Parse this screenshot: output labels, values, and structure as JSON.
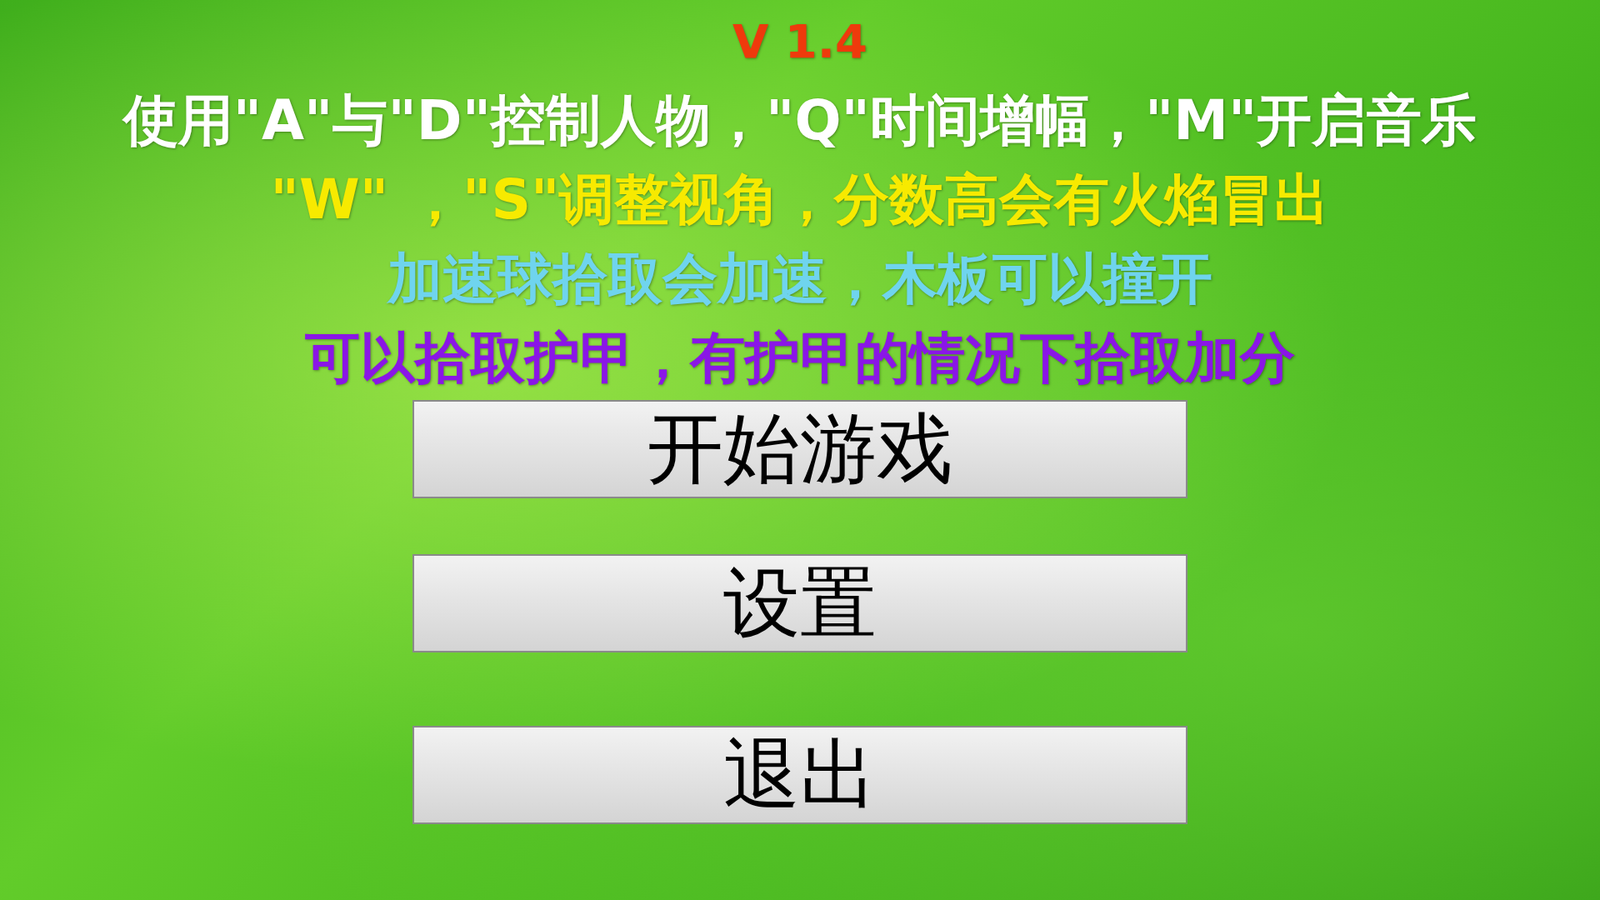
{
  "version": {
    "text": "V 1.4",
    "color": "#ee3a0c"
  },
  "instructions": [
    {
      "text": "使用\"A\"与\"D\"控制人物，\"Q\"时间增幅，\"M\"开启音乐",
      "color": "#ffffff"
    },
    {
      "text": "\"W\" ，\"S\"调整视角，分数高会有火焰冒出",
      "color": "#f7ea00"
    },
    {
      "text": "加速球拾取会加速，木板可以撞开",
      "color": "#6fd4ee"
    },
    {
      "text": "可以拾取护甲，有护甲的情况下拾取加分",
      "color": "#8a16e6"
    }
  ],
  "buttons": [
    "开始游戏",
    "设置",
    "退出"
  ]
}
